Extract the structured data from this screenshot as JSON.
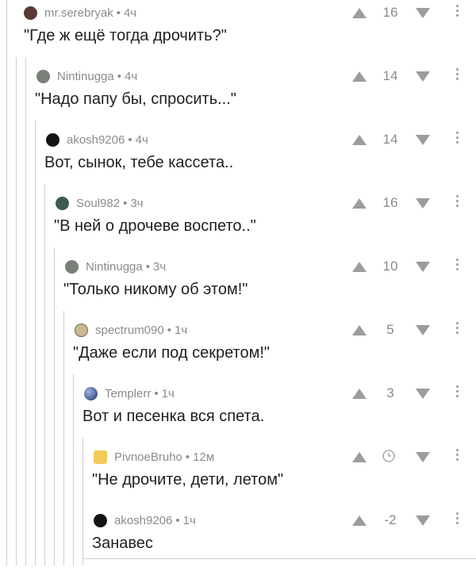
{
  "comments": [
    {
      "user": "mr.serebryak",
      "time": "4ч",
      "score": "16",
      "text": "\"Где ж ещё тогда дрочить?\""
    },
    {
      "user": "Nintinugga",
      "time": "4ч",
      "score": "14",
      "text": "\"Надо папу бы, спросить...\""
    },
    {
      "user": "akosh9206",
      "time": "4ч",
      "score": "14",
      "text": "Вот, сынок, тебе кассета.."
    },
    {
      "user": "Soul982",
      "time": "3ч",
      "score": "16",
      "text": "\"В ней о дрочеве воспето..\""
    },
    {
      "user": "Nintinugga",
      "time": "3ч",
      "score": "10",
      "text": "\"Только никому об этом!\""
    },
    {
      "user": "spectrum090",
      "time": "1ч",
      "score": "5",
      "text": "\"Даже если под секретом!\""
    },
    {
      "user": "Templerr",
      "time": "1ч",
      "score": "3",
      "text": "Вот и песенка вся спета."
    },
    {
      "user": "PivnoeBruho",
      "time": "12м",
      "score": "",
      "text": "\"Не дрочите, дети, летом\"",
      "score_icon": "clock-icon"
    },
    {
      "user": "akosh9206",
      "time": "1ч",
      "score": "-2",
      "text": "Занавес"
    }
  ],
  "separator": "•",
  "colors": {
    "meta": "#8b8b8b",
    "vote_arrow": "#9c9c9c",
    "thread_line": "#cfcfcf"
  }
}
